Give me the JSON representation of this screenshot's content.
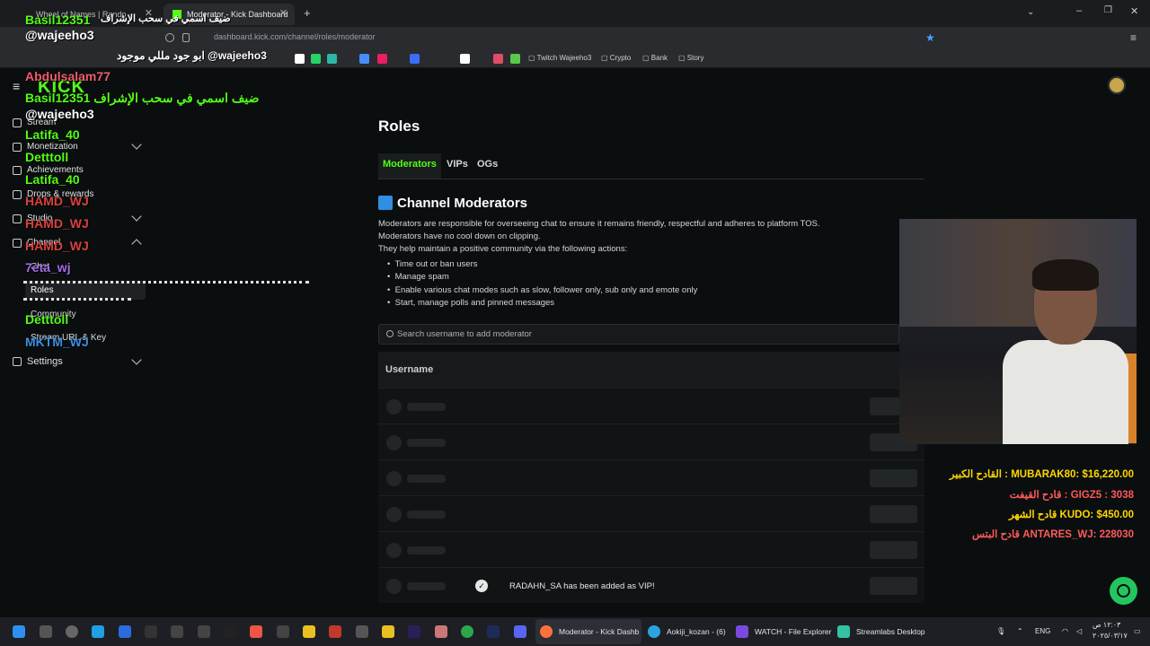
{
  "browser": {
    "tabs": [
      {
        "label": "Wheel of Names | Rando"
      },
      {
        "label": "Moderator - Kick Dashboard"
      }
    ],
    "url": "dashboard.kick.com/channel/roles/moderator",
    "bookmarks": [
      "Twitch Wajeeho3",
      "Crypto",
      "Bank",
      "Story"
    ]
  },
  "sidebar": {
    "items": [
      {
        "label": "Stream",
        "expandable": false
      },
      {
        "label": "Monetization",
        "expandable": true
      },
      {
        "label": "Achievements",
        "expandable": false
      },
      {
        "label": "Drops & rewards",
        "expandable": false
      },
      {
        "label": "Studio",
        "expandable": true
      },
      {
        "label": "Channel",
        "expandable": true,
        "expanded": true
      },
      {
        "label": "Settings",
        "expandable": true
      }
    ],
    "channel_sub": [
      "Chat",
      "Roles",
      "Community",
      "Stream URL & Key"
    ]
  },
  "chat_overlay": [
    {
      "text": "Basil12351",
      "color": "#53fc18"
    },
    {
      "text": "ضيف اسمي في سحب الإشراف",
      "color": "#ffffff"
    },
    {
      "text": "@wajeeho3",
      "color": "#ffffff"
    },
    {
      "text": "ابو جود مللي موجود @wajeeho3",
      "color": "#ffffff"
    },
    {
      "text": "Abdulsalam77",
      "color": "#f05c6e"
    },
    {
      "text": "Basil12351 ضيف اسمي في سحب الإشراف",
      "color": "#53fc18"
    },
    {
      "text": "@wajeeho3",
      "color": "#ffffff"
    },
    {
      "text": "Latifa_40",
      "color": "#53fc18"
    },
    {
      "text": "Detttoll",
      "color": "#53fc18"
    },
    {
      "text": "Latifa_40",
      "color": "#53fc18"
    },
    {
      "text": "HAMD_WJ",
      "color": "#d9413c"
    },
    {
      "text": "HAMD_WJ",
      "color": "#d9413c"
    },
    {
      "text": "HAMD_WJ",
      "color": "#d9413c"
    },
    {
      "text": "7eta_wj",
      "color": "#a66ae8"
    },
    {
      "text": "Detttoll",
      "color": "#53fc18"
    },
    {
      "text": "MKTM_WJ",
      "color": "#3d8ee0"
    }
  ],
  "main": {
    "title": "Roles",
    "tabs": [
      "Moderators",
      "VIPs",
      "OGs"
    ],
    "section_title": "Channel Moderators",
    "desc": [
      "Moderators are responsible for overseeing chat to ensure it remains friendly, respectful and adheres to platform TOS.",
      "Moderators have no cool down on clipping.",
      "They help maintain a positive community via the following actions:"
    ],
    "actions": [
      "Time out or ban users",
      "Manage spam",
      "Enable various chat modes such as slow, follower only, sub only and emote only",
      "Start, manage polls and pinned messages"
    ],
    "search_placeholder": "Search username to add moderator",
    "table_header": "Username",
    "toast": "RADAHN_SA has been added as VIP!"
  },
  "donations": [
    {
      "text": "القادح الكبير : MUBARAK80: $16,220.00",
      "color": "#ffd700"
    },
    {
      "text": "قادح القيفت : GIGZ5 : 3038",
      "color": "#ff5a5a"
    },
    {
      "text": "قادح الشهر KUDO: $450.00",
      "color": "#ffd700"
    },
    {
      "text": "قادح البتس ANTARES_WJ: 228030",
      "color": "#ff5a5a"
    }
  ],
  "taskbar": {
    "apps": [
      "Moderator - Kick Dashb",
      "Aokiji_kozan - (6)",
      "WATCH - File Explorer",
      "Streamlabs Desktop"
    ],
    "lang": "ENG",
    "time": "١٢:٠٣ ص",
    "date": "٢٠٢٥/٠٣/١٧"
  }
}
